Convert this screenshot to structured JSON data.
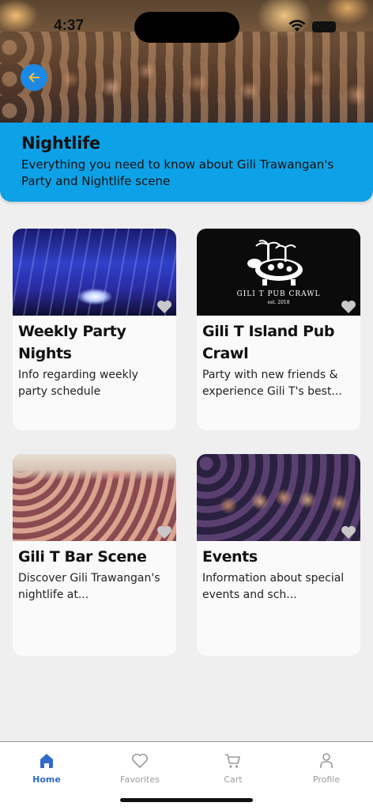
{
  "status_bar": {
    "time": "4:37"
  },
  "header": {
    "title": "Nightlife",
    "subtitle": "Everything you need to know about Gili Trawangan's Party and Nightlife scene"
  },
  "cards": [
    {
      "title": "Weekly Party Nights",
      "description": "Info regarding weekly party schedule",
      "image_icon": "party-hall-image"
    },
    {
      "title": "Gili T Island Pub Crawl",
      "description": "Party with new friends & experience Gili T's best...",
      "image_icon": "pub-crawl-logo-image",
      "logo_text": "GILI T PUB CRAWL",
      "logo_est": "est. 2018"
    },
    {
      "title": "Gili T Bar Scene",
      "description": "Discover Gili Trawangan's nightlife at...",
      "image_icon": "bar-crowd-image"
    },
    {
      "title": "Events",
      "description": "Information about special events and sch...",
      "image_icon": "events-crowd-image"
    }
  ],
  "nav": {
    "items": [
      {
        "label": "Home",
        "icon": "home-icon",
        "active": true
      },
      {
        "label": "Favorites",
        "icon": "heart-icon",
        "active": false
      },
      {
        "label": "Cart",
        "icon": "cart-icon",
        "active": false
      },
      {
        "label": "Profile",
        "icon": "person-icon",
        "active": false
      }
    ]
  },
  "colors": {
    "header_bg": "#0da2e7",
    "back_button": "#1e88e5",
    "nav_active": "#2e6ac8",
    "nav_inactive": "#9b9b9b",
    "page_bg": "#efefef"
  }
}
